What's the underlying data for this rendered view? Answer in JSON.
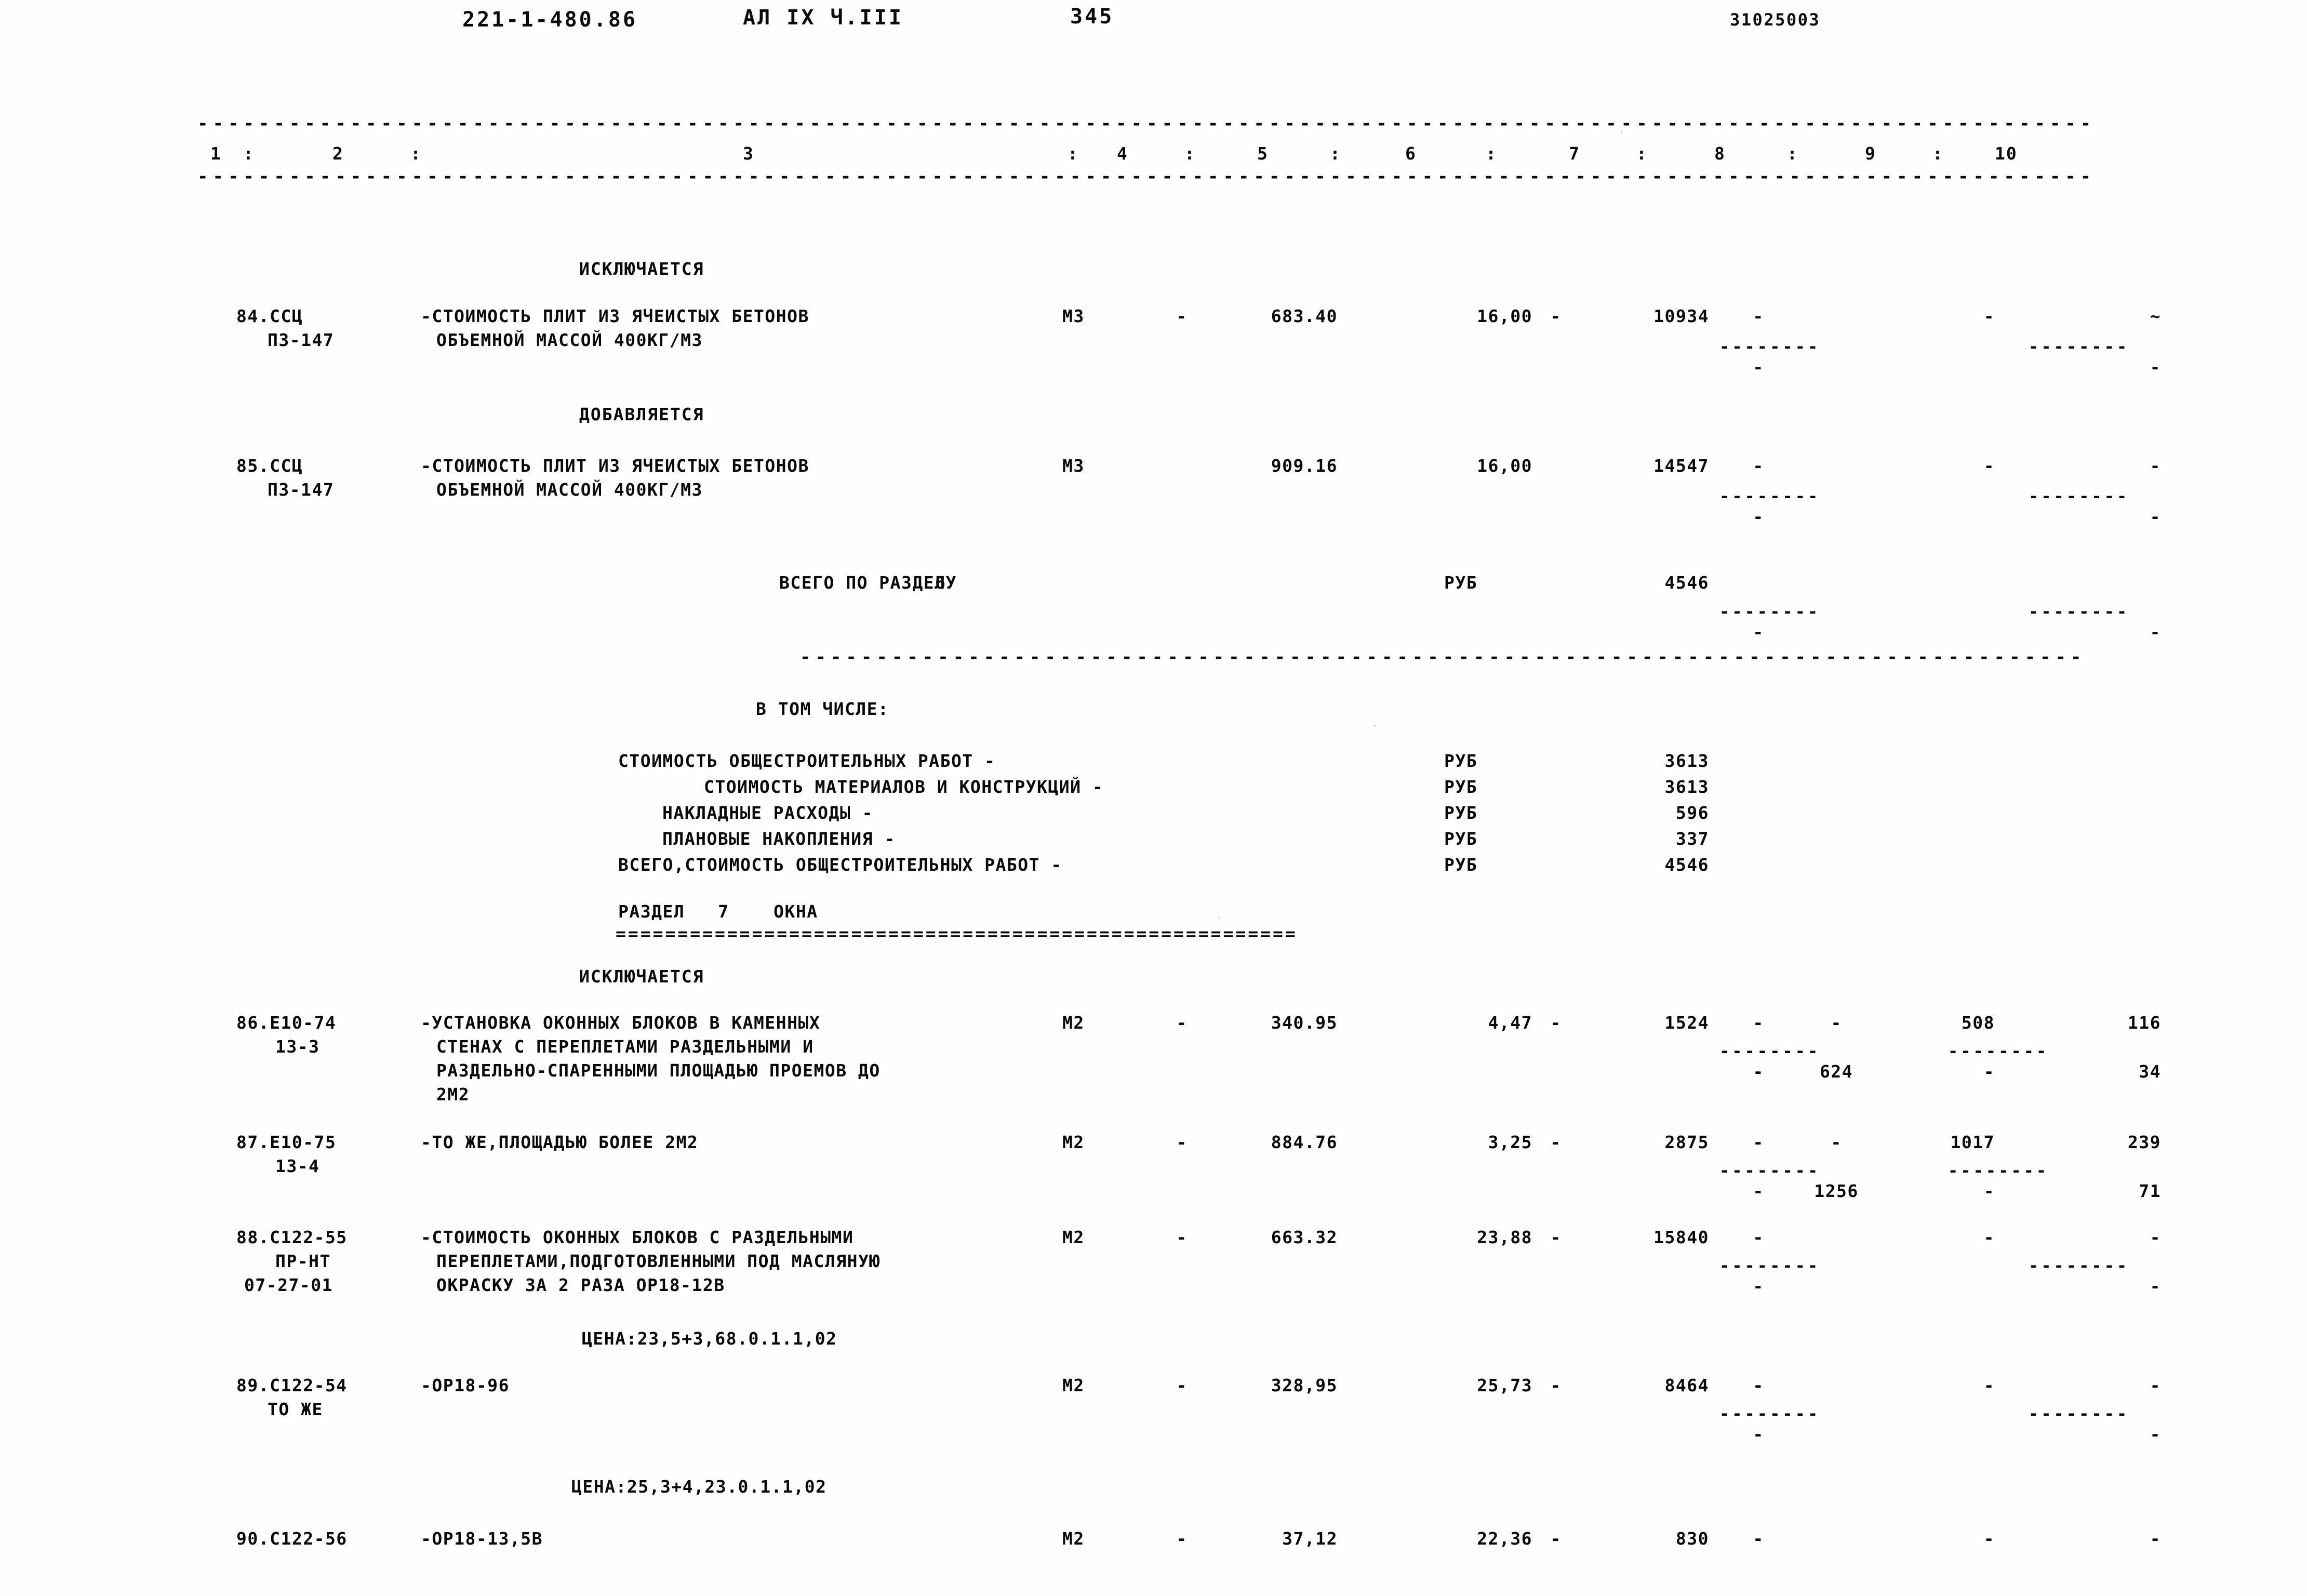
{
  "header": {
    "doc_code": "221-1-480.86",
    "album": "АЛ IX Ч.III",
    "page_number": "345",
    "right_code": "31025003"
  },
  "table": {
    "column_numbers": [
      "1",
      "2",
      "3",
      "4",
      "5",
      "6",
      "7",
      "8",
      "9",
      "10"
    ],
    "separator_dash": "-",
    "rule_char": "-",
    "colon": ":"
  },
  "sections": {
    "excluded_label_1": "ИСКЛЮЧАЕТСЯ",
    "added_label": "ДОБАВЛЯЕТСЯ",
    "total_label": "ВСЕГО ПО РАЗДЕЛУ",
    "total_section_number": "6",
    "including_label": "В ТОМ ЧИСЛЕ:",
    "section7_label": "РАЗДЕЛ   7    ОКНА",
    "section7_rule": "=======================================================",
    "excluded_label_2": "ИСКЛЮЧАЕТСЯ"
  },
  "rows": [
    {
      "no": "84.ССЦ",
      "code2": "ПЗ-147",
      "desc": [
        "-СТОИМОСТЬ ПЛИТ ИЗ ЯЧЕИСТЫХ БЕТОНОВ",
        "ОБЪЕМНОЙ МАССОЙ 400КГ/М3"
      ],
      "unit": "М3",
      "c4": "-",
      "c5": "683.40",
      "c6": "16,00",
      "c6dash": "-",
      "c7": "10934",
      "c8a": "-",
      "c8b": "",
      "c9": "-",
      "c10": "~",
      "c8a_2": "-",
      "c8b_2": "",
      "c9_2": "",
      "c10_2": "-",
      "has_underline_8": true,
      "has_underline_10": true
    },
    {
      "no": "85.ССЦ",
      "code2": "ПЗ-147",
      "desc": [
        "-СТОИМОСТЬ ПЛИТ ИЗ ЯЧЕИСТЫХ БЕТОНОВ",
        "ОБЪЕМНОЙ МАССОЙ 400КГ/М3"
      ],
      "unit": "М3",
      "c4": "",
      "c5": "909.16",
      "c6": "16,00",
      "c6dash": "",
      "c7": "14547",
      "c8a": "-",
      "c8b": "",
      "c9": "-",
      "c10": "-",
      "c8a_2": "-",
      "c8b_2": "",
      "c9_2": "",
      "c10_2": "-",
      "has_underline_8": true,
      "has_underline_10": true
    },
    {
      "no": "86.Е10-74",
      "code2": "13-3",
      "desc": [
        "-УСТАНОВКА ОКОННЫХ БЛОКОВ В КАМЕННЫХ",
        "СТЕНАХ С ПЕРЕПЛЕТАМИ РАЗДЕЛЬНЫМИ И",
        "РАЗДЕЛЬНО-СПАРЕННЫМИ ПЛОЩАДЬЮ ПРОЕМОВ ДО",
        "2М2"
      ],
      "unit": "М2",
      "c4": "-",
      "c5": "340.95",
      "c6": "4,47",
      "c6dash": "-",
      "c7": "1524",
      "c8a": "-",
      "c8b": "-",
      "c9": "508",
      "c10": "116",
      "c8a_2": "-",
      "c8b_2": "624",
      "c9_2": "-",
      "c10_2": "34",
      "has_underline_8": true,
      "has_underline_10": true
    },
    {
      "no": "87.Е10-75",
      "code2": "13-4",
      "desc": [
        "-ТО ЖЕ,ПЛОЩАДЬЮ БОЛЕЕ 2М2"
      ],
      "unit": "М2",
      "c4": "-",
      "c5": "884.76",
      "c6": "3,25",
      "c6dash": "-",
      "c7": "2875",
      "c8a": "-",
      "c8b": "-",
      "c9": "1017",
      "c10": "239",
      "c8a_2": "-",
      "c8b_2": "1256",
      "c9_2": "-",
      "c10_2": "71",
      "has_underline_8": true,
      "has_underline_10": true
    },
    {
      "no": "88.С122-55",
      "code2": "ПР-НТ",
      "code3": "07-27-01",
      "desc": [
        "-СТОИМОСТЬ ОКОННЫХ БЛОКОВ С РАЗДЕЛЬНЫМИ",
        "ПЕРЕПЛЕТАМИ,ПОДГОТОВЛЕННЫМИ ПОД МАСЛЯНУЮ",
        "ОКРАСКУ ЗА 2 РАЗА ОР18-12В"
      ],
      "unit": "М2",
      "c4": "-",
      "c5": "663.32",
      "c6": "23,88",
      "c6dash": "-",
      "c7": "15840",
      "c8a": "-",
      "c8b": "",
      "c9": "-",
      "c10": "-",
      "c8a_2": "-",
      "c8b_2": "",
      "c9_2": "",
      "c10_2": "-",
      "has_underline_8": true,
      "has_underline_10": true,
      "price_note": "ЦЕНА:23,5+3,68.0.1.1,02"
    },
    {
      "no": "89.С122-54",
      "code2": "ТО ЖЕ",
      "desc": [
        "-ОР18-96"
      ],
      "unit": "М2",
      "c4": "-",
      "c5": "328,95",
      "c6": "25,73",
      "c6dash": "-",
      "c7": "8464",
      "c8a": "-",
      "c8b": "",
      "c9": "-",
      "c10": "-",
      "c8a_2": "-",
      "c8b_2": "",
      "c9_2": "",
      "c10_2": "-",
      "has_underline_8": true,
      "has_underline_10": true,
      "price_note": "ЦЕНА:25,3+4,23.0.1.1,02"
    },
    {
      "no": "90.С122-56",
      "code2": "",
      "desc": [
        "-ОР18-13,5В"
      ],
      "unit": "М2",
      "c4": "-",
      "c5": "37,12",
      "c6": "22,36",
      "c6dash": "-",
      "c7": "830",
      "c8a": "-",
      "c8b": "",
      "c9": "-",
      "c10": "-",
      "c8a_2": "",
      "c8b_2": "",
      "c9_2": "",
      "c10_2": "",
      "has_underline_8": false,
      "has_underline_10": false
    }
  ],
  "totals": {
    "unit": "РУБ",
    "value": "4546"
  },
  "breakdown": [
    {
      "label": "СТОИМОСТЬ ОБЩЕСТРОИТЕЛЬНЫХ РАБОТ -",
      "indent": 0,
      "unit": "РУБ",
      "value": "3613"
    },
    {
      "label": "СТОИМОСТЬ МАТЕРИАЛОВ И КОНСТРУКЦИЙ -",
      "indent": 1,
      "unit": "РУБ",
      "value": "3613"
    },
    {
      "label": "НАКЛАДНЫЕ РАСХОДЫ -",
      "indent": 2,
      "unit": "РУБ",
      "value": "596"
    },
    {
      "label": "ПЛАНОВЫЕ НАКОПЛЕНИЯ -",
      "indent": 3,
      "unit": "РУБ",
      "value": "337"
    },
    {
      "label": "ВСЕГО,СТОИМОСТЬ ОБЩЕСТРОИТЕЛЬНЫХ РАБОТ -",
      "indent": 4,
      "unit": "РУБ",
      "value": "4546"
    }
  ]
}
